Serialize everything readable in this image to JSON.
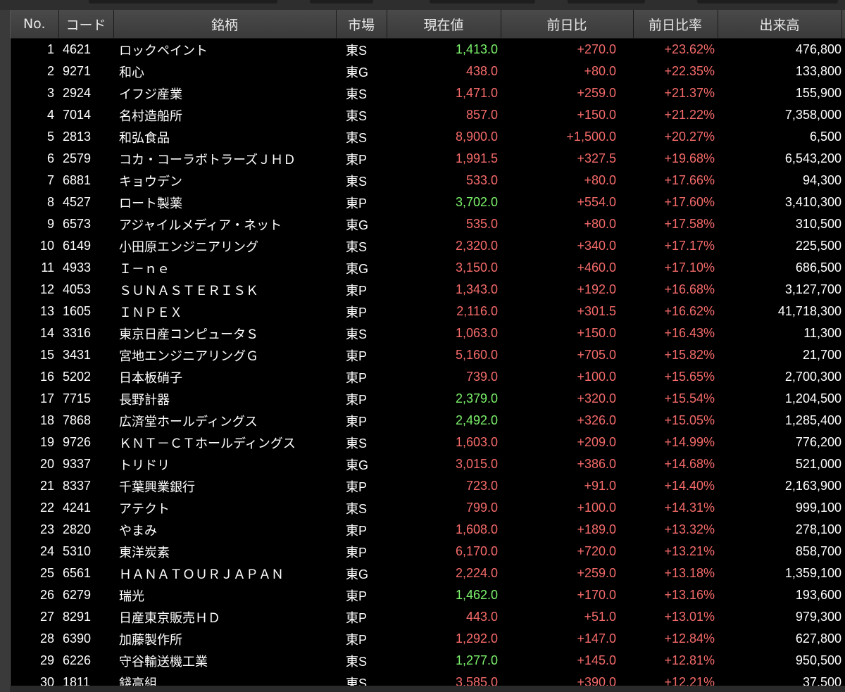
{
  "colors": {
    "up": "#f56a6a",
    "highlight": "#7cf36b",
    "text": "#ffffff",
    "background": "#000000"
  },
  "header": {
    "no": "No.",
    "code": "コード",
    "name": "銘柄",
    "market": "市場",
    "price": "現在値",
    "change": "前日比",
    "change_pct": "前日比率",
    "volume": "出来高"
  },
  "rows": [
    {
      "no": "1",
      "code": "4621",
      "name": "ロックペイント",
      "market": "東S",
      "price": "1,413.0",
      "price_color": "highlight",
      "change": "+270.0",
      "change_pct": "+23.62%",
      "volume": "476,800"
    },
    {
      "no": "2",
      "code": "9271",
      "name": "和心",
      "market": "東G",
      "price": "438.0",
      "price_color": "up",
      "change": "+80.0",
      "change_pct": "+22.35%",
      "volume": "133,800"
    },
    {
      "no": "3",
      "code": "2924",
      "name": "イフジ産業",
      "market": "東S",
      "price": "1,471.0",
      "price_color": "up",
      "change": "+259.0",
      "change_pct": "+21.37%",
      "volume": "155,900"
    },
    {
      "no": "4",
      "code": "7014",
      "name": "名村造船所",
      "market": "東S",
      "price": "857.0",
      "price_color": "up",
      "change": "+150.0",
      "change_pct": "+21.22%",
      "volume": "7,358,000"
    },
    {
      "no": "5",
      "code": "2813",
      "name": "和弘食品",
      "market": "東S",
      "price": "8,900.0",
      "price_color": "up",
      "change": "+1,500.0",
      "change_pct": "+20.27%",
      "volume": "6,500"
    },
    {
      "no": "6",
      "code": "2579",
      "name": "コカ・コーラボトラーズＪＨＤ",
      "market": "東P",
      "price": "1,991.5",
      "price_color": "up",
      "change": "+327.5",
      "change_pct": "+19.68%",
      "volume": "6,543,200"
    },
    {
      "no": "7",
      "code": "6881",
      "name": "キョウデン",
      "market": "東S",
      "price": "533.0",
      "price_color": "up",
      "change": "+80.0",
      "change_pct": "+17.66%",
      "volume": "94,300"
    },
    {
      "no": "8",
      "code": "4527",
      "name": "ロート製薬",
      "market": "東P",
      "price": "3,702.0",
      "price_color": "highlight",
      "change": "+554.0",
      "change_pct": "+17.60%",
      "volume": "3,410,300"
    },
    {
      "no": "9",
      "code": "6573",
      "name": "アジャイルメディア・ネット",
      "market": "東G",
      "price": "535.0",
      "price_color": "up",
      "change": "+80.0",
      "change_pct": "+17.58%",
      "volume": "310,500"
    },
    {
      "no": "10",
      "code": "6149",
      "name": "小田原エンジニアリング",
      "market": "東S",
      "price": "2,320.0",
      "price_color": "up",
      "change": "+340.0",
      "change_pct": "+17.17%",
      "volume": "225,500"
    },
    {
      "no": "11",
      "code": "4933",
      "name": "Ｉ－ｎｅ",
      "market": "東G",
      "price": "3,150.0",
      "price_color": "up",
      "change": "+460.0",
      "change_pct": "+17.10%",
      "volume": "686,500"
    },
    {
      "no": "12",
      "code": "4053",
      "name": "ＳＵＮＡＳＴＥＲＩＳＫ",
      "market": "東P",
      "price": "1,343.0",
      "price_color": "up",
      "change": "+192.0",
      "change_pct": "+16.68%",
      "volume": "3,127,700"
    },
    {
      "no": "13",
      "code": "1605",
      "name": "ＩＮＰＥＸ",
      "market": "東P",
      "price": "2,116.0",
      "price_color": "up",
      "change": "+301.5",
      "change_pct": "+16.62%",
      "volume": "41,718,300"
    },
    {
      "no": "14",
      "code": "3316",
      "name": "東京日産コンピュータＳ",
      "market": "東S",
      "price": "1,063.0",
      "price_color": "up",
      "change": "+150.0",
      "change_pct": "+16.43%",
      "volume": "11,300"
    },
    {
      "no": "15",
      "code": "3431",
      "name": "宮地エンジニアリングＧ",
      "market": "東P",
      "price": "5,160.0",
      "price_color": "up",
      "change": "+705.0",
      "change_pct": "+15.82%",
      "volume": "21,700"
    },
    {
      "no": "16",
      "code": "5202",
      "name": "日本板硝子",
      "market": "東P",
      "price": "739.0",
      "price_color": "up",
      "change": "+100.0",
      "change_pct": "+15.65%",
      "volume": "2,700,300"
    },
    {
      "no": "17",
      "code": "7715",
      "name": "長野計器",
      "market": "東P",
      "price": "2,379.0",
      "price_color": "highlight",
      "change": "+320.0",
      "change_pct": "+15.54%",
      "volume": "1,204,500"
    },
    {
      "no": "18",
      "code": "7868",
      "name": "広済堂ホールディングス",
      "market": "東P",
      "price": "2,492.0",
      "price_color": "highlight",
      "change": "+326.0",
      "change_pct": "+15.05%",
      "volume": "1,285,400"
    },
    {
      "no": "19",
      "code": "9726",
      "name": "ＫＮＴ－ＣＴホールディングス",
      "market": "東S",
      "price": "1,603.0",
      "price_color": "up",
      "change": "+209.0",
      "change_pct": "+14.99%",
      "volume": "776,200"
    },
    {
      "no": "20",
      "code": "9337",
      "name": "トリドリ",
      "market": "東G",
      "price": "3,015.0",
      "price_color": "up",
      "change": "+386.0",
      "change_pct": "+14.68%",
      "volume": "521,000"
    },
    {
      "no": "21",
      "code": "8337",
      "name": "千葉興業銀行",
      "market": "東P",
      "price": "723.0",
      "price_color": "up",
      "change": "+91.0",
      "change_pct": "+14.40%",
      "volume": "2,163,900"
    },
    {
      "no": "22",
      "code": "4241",
      "name": "アテクト",
      "market": "東S",
      "price": "799.0",
      "price_color": "up",
      "change": "+100.0",
      "change_pct": "+14.31%",
      "volume": "999,100"
    },
    {
      "no": "23",
      "code": "2820",
      "name": "やまみ",
      "market": "東P",
      "price": "1,608.0",
      "price_color": "up",
      "change": "+189.0",
      "change_pct": "+13.32%",
      "volume": "278,100"
    },
    {
      "no": "24",
      "code": "5310",
      "name": "東洋炭素",
      "market": "東P",
      "price": "6,170.0",
      "price_color": "up",
      "change": "+720.0",
      "change_pct": "+13.21%",
      "volume": "858,700"
    },
    {
      "no": "25",
      "code": "6561",
      "name": "ＨＡＮＡＴＯＵＲＪＡＰＡＮ",
      "market": "東G",
      "price": "2,224.0",
      "price_color": "up",
      "change": "+259.0",
      "change_pct": "+13.18%",
      "volume": "1,359,100"
    },
    {
      "no": "26",
      "code": "6279",
      "name": "瑞光",
      "market": "東P",
      "price": "1,462.0",
      "price_color": "highlight",
      "change": "+170.0",
      "change_pct": "+13.16%",
      "volume": "193,600"
    },
    {
      "no": "27",
      "code": "8291",
      "name": "日産東京販売ＨＤ",
      "market": "東P",
      "price": "443.0",
      "price_color": "up",
      "change": "+51.0",
      "change_pct": "+13.01%",
      "volume": "979,300"
    },
    {
      "no": "28",
      "code": "6390",
      "name": "加藤製作所",
      "market": "東P",
      "price": "1,292.0",
      "price_color": "up",
      "change": "+147.0",
      "change_pct": "+12.84%",
      "volume": "627,800"
    },
    {
      "no": "29",
      "code": "6226",
      "name": "守谷輸送機工業",
      "market": "東S",
      "price": "1,277.0",
      "price_color": "highlight",
      "change": "+145.0",
      "change_pct": "+12.81%",
      "volume": "950,500"
    },
    {
      "no": "30",
      "code": "1811",
      "name": "錢高組",
      "market": "東S",
      "price": "3,585.0",
      "price_color": "up",
      "change": "+390.0",
      "change_pct": "+12.21%",
      "volume": "37,500"
    }
  ]
}
